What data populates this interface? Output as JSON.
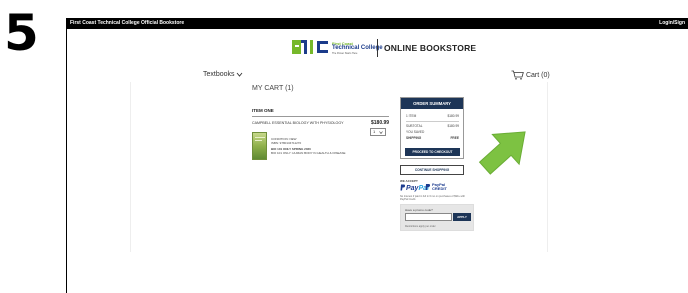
{
  "step": {
    "number": "5"
  },
  "topbar": {
    "site_name": "First Coast Technical College Official Bookstore",
    "login": "Login/Sign"
  },
  "brand": {
    "logo_small": "First Coast",
    "logo_main": "Technical College",
    "logo_tag": "The Power Starts Here",
    "store_title": "ONLINE BOOKSTORE",
    "accent_green": "#76b82a",
    "accent_navy": "#1d3557"
  },
  "nav": {
    "textbooks": "Textbooks",
    "cart": "Cart (0)"
  },
  "cart": {
    "heading": "MY CART (1)",
    "item_heading": "ITEM ONE",
    "item": {
      "title": "CAMPBELL ESSENTIAL BIOLOGY WITH PHYSIOLOGY",
      "price": "$180.99",
      "quantity": "1",
      "condition": "CONDITION: NEW",
      "isbn": "ISBN: 9780134711270",
      "course": "BIO 101 ONLY SPRING 2020",
      "course_note": "BIO 101 ONLY: HUMAN BODY IN HEALTH & DISEASE"
    }
  },
  "summary": {
    "heading": "ORDER SUMMARY",
    "rows": [
      {
        "label": "1 ITEM",
        "value": "$180.99"
      },
      {
        "label": "SUBTOTAL",
        "value": "$180.99"
      },
      {
        "label": "YOU SAVED",
        "value": ""
      },
      {
        "label": "SHIPPING",
        "value": "FREE"
      }
    ],
    "checkout_label": "PROCEED TO CHECKOUT",
    "continue_label": "CONTINUE SHOPPING"
  },
  "payment": {
    "we_accept": "WE ACCEPT",
    "paypal_a": "Pay",
    "paypal_b": "Pal",
    "paypal_credit_a": "PayPal",
    "paypal_credit_b": "CREDIT",
    "note": "No Interest if paid in full in 6 mo on purchases of $99+ with PayPal Credit."
  },
  "promo": {
    "label": "Have a promo code?",
    "placeholder": "",
    "apply_label": "APPLY",
    "note": "Restrictions apply per order"
  },
  "arrow_color": "#7dc242"
}
